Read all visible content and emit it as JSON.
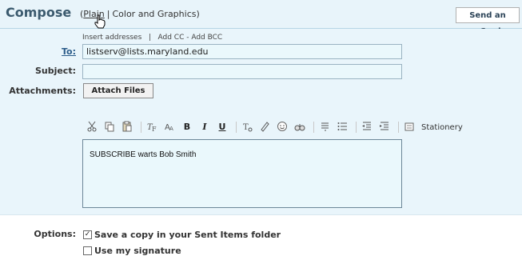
{
  "header": {
    "title": "Compose",
    "format_open": "(",
    "format_plain": "Plain",
    "format_sep": "|",
    "format_color": "Color and Graphics)",
    "send_ecard": "Send an eCard"
  },
  "address_links": {
    "insert": "Insert addresses",
    "sep": "|",
    "add_cc_bcc": "Add CC - Add BCC"
  },
  "fields": {
    "to_label": "To:",
    "to_value": "listserv@lists.maryland.edu",
    "subject_label": "Subject:",
    "subject_value": "",
    "attachments_label": "Attachments:",
    "attach_button": "Attach Files"
  },
  "toolbar": {
    "icons": [
      "cut-icon",
      "copy-icon",
      "paste-icon",
      "font-face-icon",
      "font-size-icon",
      "bold-icon",
      "italic-icon",
      "underline-icon",
      "text-color-icon",
      "highlight-icon",
      "emoticon-icon",
      "spellcheck-icon",
      "ordered-list-icon",
      "bullet-list-icon",
      "outdent-icon",
      "indent-icon",
      "stationery-icon"
    ],
    "bold": "B",
    "italic": "I",
    "underline": "U",
    "stationery": "Stationery"
  },
  "body_text": "SUBSCRIBE warts Bob Smith",
  "options": {
    "label": "Options:",
    "save_copy": "Save a copy in your Sent Items folder",
    "save_copy_checked": true,
    "use_signature": "Use my signature",
    "use_signature_checked": false
  },
  "colors": {
    "header_bg": "#e8f4fa",
    "form_bg": "#e9f5fb",
    "input_bg": "#eaf8fc",
    "title": "#3b5a6e",
    "watermark": "#d9eef8"
  }
}
